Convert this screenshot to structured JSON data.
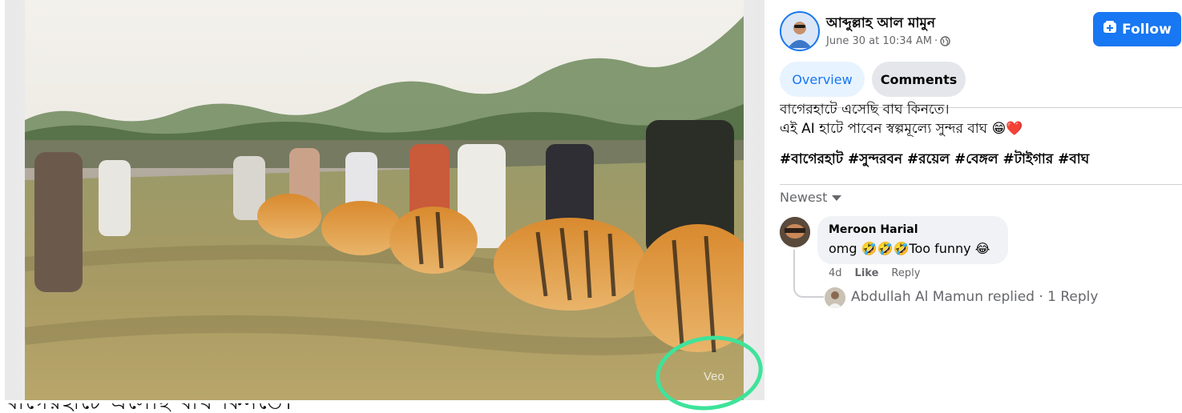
{
  "post": {
    "author": "আব্দুল্লাহ আল মামুন",
    "timestamp": "June 30 at 10:34 AM",
    "separator": "·",
    "privacy_icon": "globe-icon",
    "follow_label": "Follow",
    "follow_icon": "add-friend-icon",
    "tabs": [
      {
        "label": "Overview",
        "active": true
      },
      {
        "label": "Comments",
        "active": false
      }
    ],
    "text_line1": "বাগেরহাটে এসেছি বাঘ কিনতে।",
    "text_line2": "এই AI হাটে পাবেন স্বল্পমূল্যে সুন্দর বাঘ 😁❤️",
    "hashtags": "#বাগেরহাট #সুন্দরবন #রয়েল #বেঙ্গল #টাইগার #বাঘ"
  },
  "media": {
    "watermark": "Veo",
    "highlight_color": "#3ee39a",
    "cut_caption": "বাগেরহাটে এসেছি বাঘ কিনতে।"
  },
  "comments": {
    "sort_label": "Newest",
    "items": [
      {
        "name": "Meroon Harial",
        "text": "omg 🤣🤣🤣Too funny 😂",
        "age": "4d",
        "like_label": "Like",
        "reply_label": "Reply"
      }
    ],
    "replies_summary": "Abdullah Al Mamun replied · 1 Reply"
  },
  "colors": {
    "accent": "#1877f2",
    "bubble": "#f0f2f5",
    "muted_text": "#65676b"
  }
}
